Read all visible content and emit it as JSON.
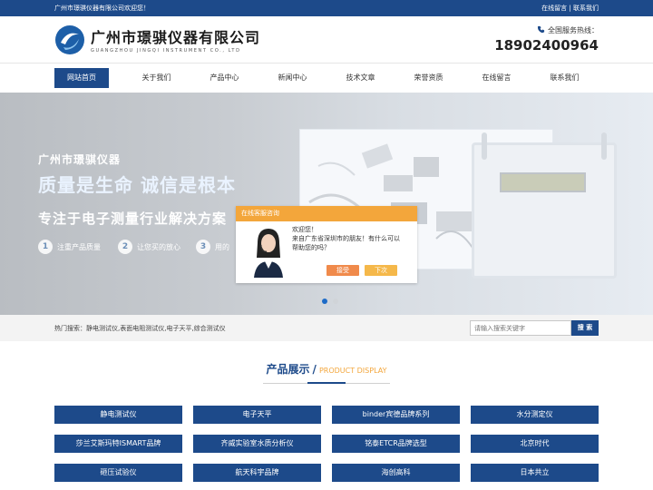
{
  "topbar": {
    "welcome": "广州市璟骐仪器有限公司欢迎您！",
    "links": [
      "在线留言",
      "联系我们"
    ],
    "separator": "|"
  },
  "header": {
    "company_cn": "广州市璟骐仪器有限公司",
    "company_en": "GUANGZHOU JINGQI INSTRUMENT CO., LTD",
    "hotline_label": "全国服务热线：",
    "hotline_number": "18902400964",
    "icon": "phone-icon"
  },
  "nav": [
    "网站首页",
    "关于我们",
    "产品中心",
    "新闻中心",
    "技术文章",
    "荣誉资质",
    "在线留言",
    "联系我们"
  ],
  "banner": {
    "subtitle": "广州市璟骐仪器",
    "title": "质量是生命 诚信是根本",
    "slogan": "专注于电子测量行业解决方案",
    "features": [
      {
        "num": "1",
        "text": "注重产品质量"
      },
      {
        "num": "2",
        "text": "让您买的放心"
      },
      {
        "num": "3",
        "text": "用的"
      }
    ],
    "active_slide": 1,
    "slides": 2
  },
  "chat": {
    "header": "在线客服咨询",
    "greeting": "欢迎您！",
    "message": "来自广东省深圳市的朋友！有什么可以帮助您的吗？",
    "accept": "接受",
    "later": "下次"
  },
  "search": {
    "hot_label": "热门搜索：",
    "hot_terms": "静电测试仪,表面电阻测试仪,电子天平,综合测试仪",
    "placeholder": "请输入搜索关键字",
    "button": "搜 索"
  },
  "products_section": {
    "title_cn": "产品展示",
    "slash": "/",
    "title_en": "PRODUCT DISPLAY"
  },
  "categories": [
    "静电测试仪",
    "电子天平",
    "binder宾德品牌系列",
    "水分测定仪",
    "莎兰艾斯玛特ISMART品牌",
    "齐威实验室水质分析仪",
    "铭泰ETCR品牌选型",
    "北京时代",
    "砸压试验仪",
    "航天科宇品牌",
    "海创高科",
    "日本共立"
  ],
  "colors": {
    "brand_blue": "#1d4a8a",
    "accent_orange": "#f3a63b"
  }
}
